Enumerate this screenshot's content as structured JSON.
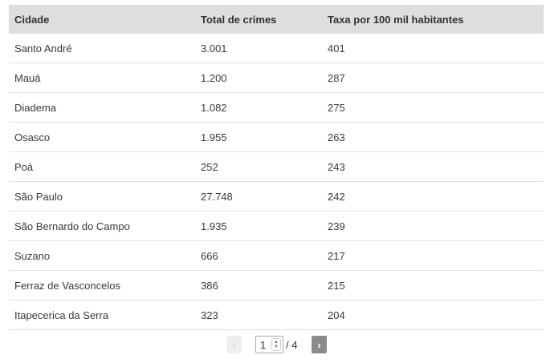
{
  "table": {
    "headers": [
      "Cidade",
      "Total de crimes",
      "Taxa por 100 mil habitantes"
    ],
    "rows": [
      [
        "Santo André",
        "3.001",
        "401"
      ],
      [
        "Mauá",
        "1.200",
        "287"
      ],
      [
        "Diadema",
        "1.082",
        "275"
      ],
      [
        "Osasco",
        "1.955",
        "263"
      ],
      [
        "Poá",
        "252",
        "243"
      ],
      [
        "São Paulo",
        "27.748",
        "242"
      ],
      [
        "São Bernardo do Campo",
        "1.935",
        "239"
      ],
      [
        "Suzano",
        "666",
        "217"
      ],
      [
        "Ferraz de Vasconcelos",
        "386",
        "215"
      ],
      [
        "Itapecerica da Serra",
        "323",
        "204"
      ]
    ]
  },
  "pagination": {
    "prev_icon": "chevron-left-icon",
    "prev_label": "‹",
    "current_page": "1",
    "total_label": "/ 4",
    "next_icon": "chevron-right-icon",
    "next_label": "›"
  }
}
